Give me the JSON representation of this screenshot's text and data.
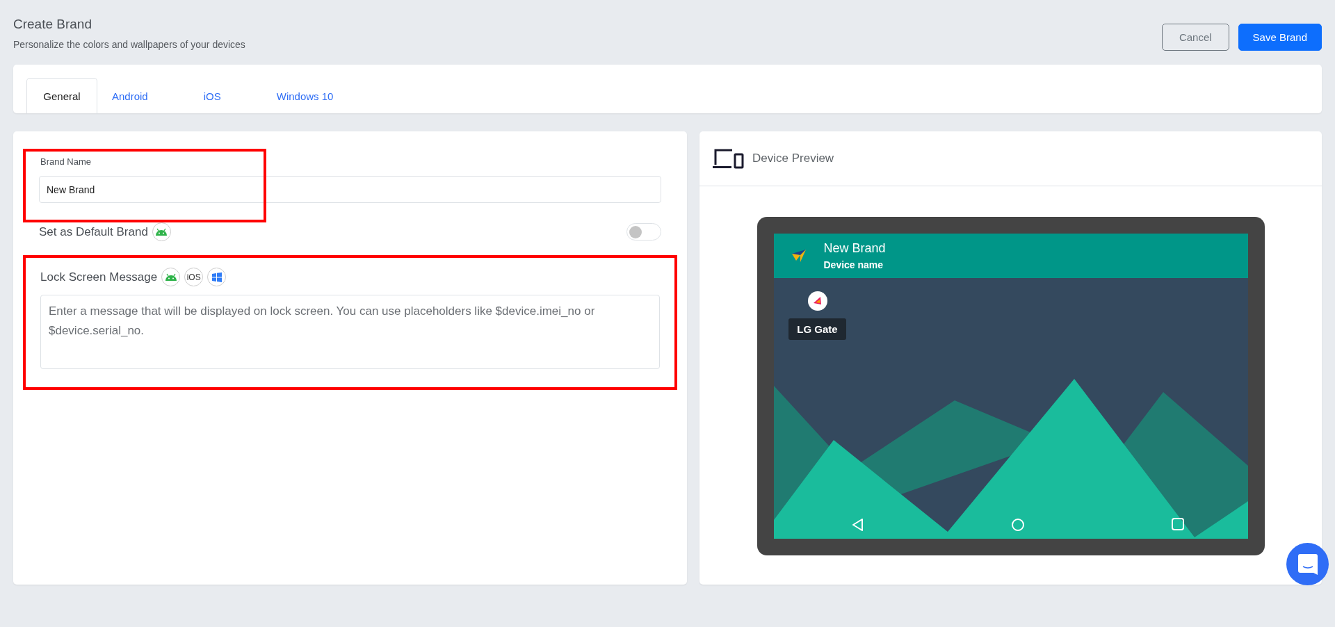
{
  "header": {
    "title": "Create Brand",
    "subtitle": "Personalize the colors and wallpapers of your devices"
  },
  "buttons": [
    {
      "label": "Cancel",
      "kind": "outline"
    },
    {
      "label": "Save Brand",
      "kind": "primary"
    }
  ],
  "tabs": [
    {
      "label": "General",
      "selected": true
    },
    {
      "label": "Android",
      "selected": false
    },
    {
      "label": "iOS",
      "selected": false
    },
    {
      "label": "Windows 10",
      "selected": false
    }
  ],
  "brand_name": {
    "label": "Brand Name",
    "value": "New Brand",
    "highlighted": true
  },
  "default_brand": {
    "label": "Set as Default Brand",
    "on": false
  },
  "lock_screen": {
    "label": "Lock Screen Message",
    "highlighted": true,
    "platforms": [
      {
        "kind": "android"
      },
      {
        "kind": "ios",
        "text": "iOS"
      },
      {
        "kind": "windows"
      }
    ],
    "placeholder": "Enter a message that will be displayed on lock screen. You can use placeholders like $device.imei_no or $device.serial_no."
  },
  "preview": {
    "title": "Device Preview",
    "brand": "New Brand",
    "device_name": "Device name",
    "app": "LG Gate"
  }
}
